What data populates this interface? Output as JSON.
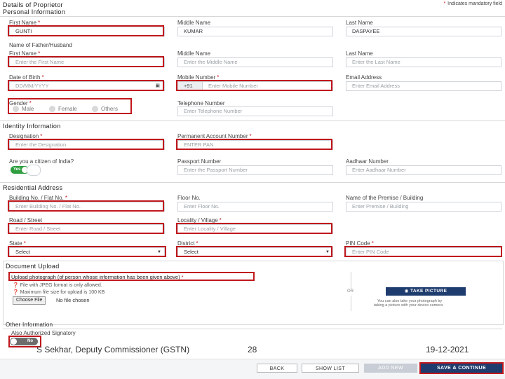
{
  "header": {
    "title": "Details of Proprietor",
    "mandatory_note": "Indicates mandatory field"
  },
  "personal": {
    "section_title": "Personal Information",
    "first_name_label": "First Name",
    "first_name_value": "GUNTI",
    "middle_name_label": "Middle Name",
    "middle_name_value": "KUMAR",
    "last_name_label": "Last Name",
    "last_name_value": "DASPAYEE",
    "father_heading": "Name of Father/Husband",
    "father_first_label": "First Name",
    "father_first_placeholder": "Enter the First Name",
    "father_middle_label": "Middle Name",
    "father_middle_placeholder": "Enter the Middle Name",
    "father_last_label": "Last Name",
    "father_last_placeholder": "Enter the Last Name",
    "dob_label": "Date of Birth",
    "dob_placeholder": "DD/MM/YYYY",
    "mobile_label": "Mobile Number",
    "mobile_prefix": "+91",
    "mobile_placeholder": "Enter Mobile Number",
    "email_label": "Email Address",
    "email_placeholder": "Enter Email Address",
    "gender_label": "Gender",
    "gender_options": [
      "Male",
      "Female",
      "Others"
    ],
    "telephone_label": "Telephone Number",
    "telephone_placeholder": "Enter Telephone Number"
  },
  "identity": {
    "section_title": "Identity Information",
    "designation_label": "Designation",
    "designation_placeholder": "Enter the Designation",
    "pan_label": "Permanent Account Number",
    "pan_placeholder": "ENTER PAN",
    "citizen_label": "Are you a citizen of India?",
    "citizen_toggle": "Yes",
    "passport_label": "Passport Number",
    "passport_placeholder": "Enter the Passport Number",
    "aadhaar_label": "Aadhaar Number",
    "aadhaar_placeholder": "Enter Aadhaar Number"
  },
  "address": {
    "section_title": "Residential Address",
    "building_label": "Building No. / Flat No.",
    "building_placeholder": "Enter Building No. / Flat No.",
    "floor_label": "Floor No.",
    "floor_placeholder": "Enter Floor No.",
    "premise_label": "Name of the Premise / Building",
    "premise_placeholder": "Enter Premise / Building",
    "road_label": "Road / Street",
    "road_placeholder": "Enter Road / Street",
    "locality_label": "Locality / Village",
    "locality_placeholder": "Enter Locality / Village",
    "state_label": "State",
    "state_value": "Select",
    "district_label": "District",
    "district_value": "Select",
    "pin_label": "PIN Code",
    "pin_placeholder": "Enter PIN Code"
  },
  "document": {
    "section_title": "Document Upload",
    "upload_label": "Upload photograph (of person whose information has been given above)",
    "hint1": "File with JPEG format is only allowed.",
    "hint2": "Maximum file size for upload is 100 KB",
    "choose_file": "Choose File",
    "no_file": "No file chosen",
    "or_text": "OR",
    "take_picture": "TAKE PICTURE",
    "camera_note_1": "You can also take your photograph by",
    "camera_note_2": "taking a picture with your device camera"
  },
  "other": {
    "section_title": "Other Information",
    "signatory_label": "Also Authorized Signatory",
    "signatory_toggle": "No"
  },
  "footer": {
    "author": "S Sekhar, Deputy Commissioner (GSTN)",
    "page_number": "28",
    "date": "19-12-2021"
  },
  "buttons": {
    "back": "BACK",
    "show_list": "SHOW LIST",
    "add_new": "ADD NEW",
    "save_continue": "SAVE & CONTINUE"
  },
  "colors": {
    "highlight": "#c0181d",
    "toggle_yes": "#2e9e3f",
    "primary_button": "#1f3c6e"
  }
}
